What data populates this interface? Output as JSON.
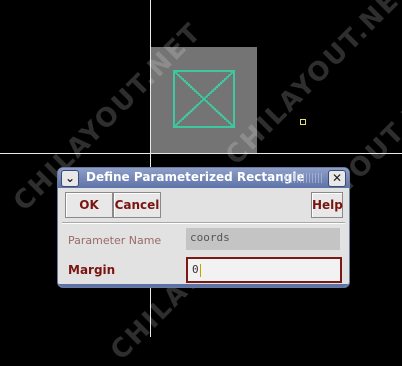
{
  "canvas": {
    "watermark_text": "CHILAYOUT.NET",
    "colors": {
      "background": "#000000",
      "axes": "#e8e8e8",
      "shape_outline": "#3fc7a0",
      "pin": "#e6e070"
    }
  },
  "dialog": {
    "title": "Define Parameterized Rectangle",
    "menu_icon": "chevron-down-icon",
    "close_icon": "close-icon",
    "buttons": {
      "ok": "OK",
      "cancel": "Cancel",
      "help": "Help"
    },
    "fields": {
      "parameter_name": {
        "label": "Parameter Name",
        "value": "coords"
      },
      "margin": {
        "label": "Margin",
        "value": "0"
      }
    },
    "colors": {
      "title_bar": "#5d72a8",
      "accent_text": "#7a1410"
    }
  }
}
